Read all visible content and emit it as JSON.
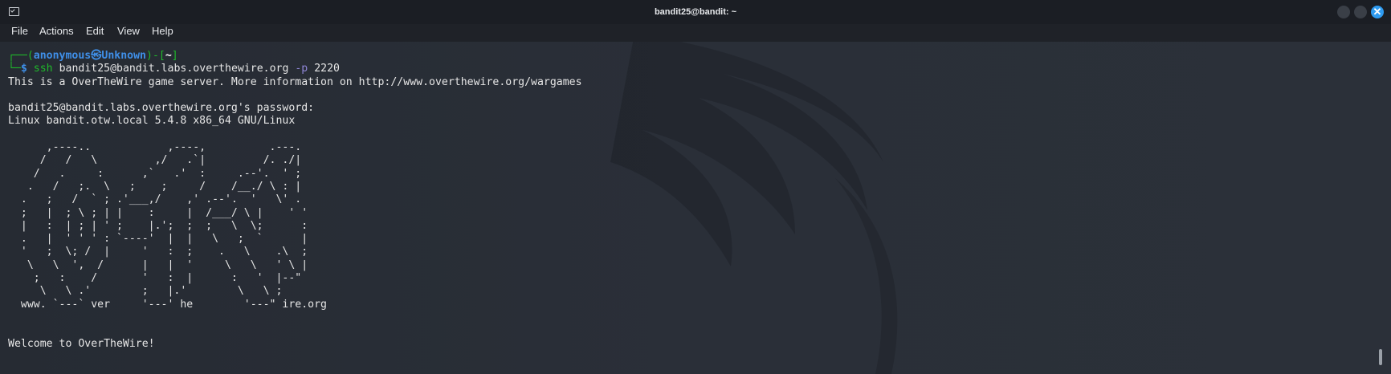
{
  "window": {
    "title": "bandit25@bandit: ~",
    "close_glyph": "✕"
  },
  "menu": {
    "items": [
      "File",
      "Actions",
      "Edit",
      "View",
      "Help"
    ]
  },
  "prompt": {
    "line1_prefix": "┌──(",
    "user": "anonymous㉿Unknown",
    "line1_mid": ")-[",
    "path": "~",
    "line1_suffix": "]",
    "line2_prefix": "└─",
    "dollar": "$",
    "command_bin": "ssh",
    "command_arg": "bandit25@bandit.labs.overthewire.org",
    "command_flag": "-p",
    "command_port": "2220"
  },
  "output": {
    "server_info": "This is a OverTheWire game server. More information on http://www.overthewire.org/wargames",
    "password_prompt": "bandit25@bandit.labs.overthewire.org's password:",
    "system_info": "Linux bandit.otw.local 5.4.8 x86_64 GNU/Linux",
    "ascii_art": [
      "      ,----..            ,----,          .---.",
      "     /   /   \\         ,/   .`|         /. ./|",
      "    /   .     :      ,`   .'  :     .--'.  ' ;",
      "   .   /   ;.  \\   ;    ;     /    /__./ \\ : |",
      "  .   ;   /  ` ; .'___,/    ,' .--'.  '   \\' .",
      "  ;   |  ; \\ ; | |    :     |  /___/ \\ |    ' '",
      "  |   :  | ; | ' ;    |.';  ;  ;   \\  \\;      :",
      "  .   |  ' ' ' : `----'  |  |   \\   ;  `      |",
      "  '   ;  \\; /  |     '   :  ;    .   \\    .\\  ;",
      "   \\   \\  ',  /      |   |  '     \\   \\   ' \\ |",
      "    ;   :    /       '   :  |      :   '  |--\"",
      "     \\   \\ .'        ;   |.'        \\   \\ ;",
      "  www. `---` ver     '---' he        '---\" ire.org"
    ],
    "welcome": "Welcome to OverTheWire!"
  },
  "colors": {
    "background": "#262b33",
    "prompt_bracket": "#1fb92a",
    "prompt_user": "#3f8fe8",
    "command": "#1fb92a",
    "flag": "#8f86d6",
    "text": "#e6e6e6"
  },
  "icons": {
    "app": "terminal-icon",
    "minimize": "minimize-icon",
    "maximize": "maximize-icon",
    "close": "close-icon"
  }
}
